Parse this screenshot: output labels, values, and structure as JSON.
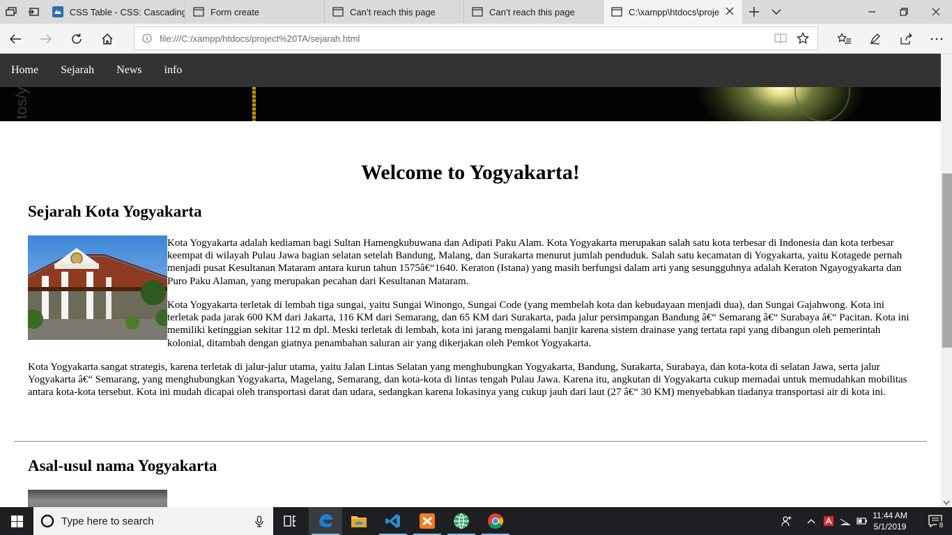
{
  "browser": {
    "tabs": [
      {
        "title": "CSS Table - CSS: Cascading",
        "icon": "mdn-icon"
      },
      {
        "title": "Form create",
        "icon": "page-icon"
      },
      {
        "title": "Can’t reach this page",
        "icon": "page-icon"
      },
      {
        "title": "Can’t reach this page",
        "icon": "page-icon"
      },
      {
        "title": "C:\\xampp\\htdocs\\proje",
        "icon": "page-icon"
      }
    ],
    "url": "file:///C:/xampp/htdocs/project%20TA/sejarah.html"
  },
  "site": {
    "nav": [
      "Home",
      "Sejarah",
      "News",
      "info"
    ],
    "banner_watermark": "tos/y",
    "title": "Welcome to Yogyakarta!",
    "sections": [
      {
        "heading": "Sejarah Kota Yogyakarta",
        "paragraphs": [
          "Kota Yogyakarta adalah kediaman bagi Sultan Hamengkubuwana dan Adipati Paku Alam. Kota Yogyakarta merupakan salah satu kota terbesar di Indonesia dan kota terbesar keempat di wilayah Pulau Jawa bagian selatan setelah Bandung, Malang, dan Surakarta menurut jumlah penduduk. Salah satu kecamatan di Yogyakarta, yaitu Kotagede pernah menjadi pusat Kesultanan Mataram antara kurun tahun 1575â€“1640. Keraton (Istana) yang masih berfungsi dalam arti yang sesungguhnya adalah Keraton Ngayogyakarta dan Puro Paku Alaman, yang merupakan pecahan dari Kesultanan Mataram.",
          "Kota Yogyakarta terletak di lembah tiga sungai, yaitu Sungai Winongo, Sungai Code (yang membelah kota dan kebudayaan menjadi dua), dan Sungai Gajahwong. Kota ini terletak pada jarak 600 KM dari Jakarta, 116 KM dari Semarang, dan 65 KM dari Surakarta, pada jalur persimpangan Bandung â€“ Semarang â€“ Surabaya â€“ Pacitan. Kota ini memiliki ketinggian sekitar 112 m dpl. Meski terletak di lembah, kota ini jarang mengalami banjir karena sistem drainase yang tertata rapi yang dibangun oleh pemerintah kolonial, ditambah dengan giatnya penambahan saluran air yang dikerjakan oleh Pemkot Yogyakarta.",
          "Kota Yogyakarta sangat strategis, karena terletak di jalur-jalur utama, yaitu Jalan Lintas Selatan yang menghubungkan Yogyakarta, Bandung, Surakarta, Surabaya, dan kota-kota di selatan Jawa, serta jalur Yogyakarta â€“ Semarang, yang menghubungkan Yogyakarta, Magelang, Semarang, dan kota-kota di lintas tengah Pulau Jawa. Karena itu, angkutan di Yogyakarta cukup memadai untuk memudahkan mobilitas antara kota-kota tersebut. Kota ini mudah dicapai oleh transportasi darat dan udara, sedangkan karena lokasinya yang cukup jauh dari laut (27 â€“ 30 KM) menyebabkan tiadanya transportasi air di kota ini."
        ]
      },
      {
        "heading": "Asal-usul nama Yogyakarta"
      }
    ]
  },
  "taskbar": {
    "search_placeholder": "Type here to search",
    "time": "11:44 AM",
    "date": "5/1/2019",
    "notification_count": "8"
  },
  "colors": {
    "site_nav_bg": "#333333",
    "taskbar_bg": "#1e1f22",
    "edge_blue": "#1e7fd6"
  }
}
